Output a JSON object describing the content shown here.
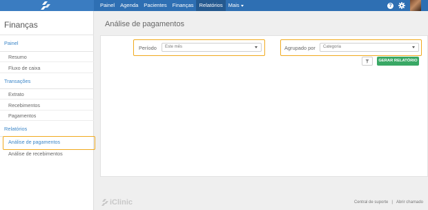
{
  "topbar": {
    "nav": [
      {
        "label": "Painel"
      },
      {
        "label": "Agenda"
      },
      {
        "label": "Pacientes"
      },
      {
        "label": "Finanças"
      },
      {
        "label": "Relatórios"
      },
      {
        "label": "Mais"
      }
    ],
    "active_nav": "Relatórios",
    "help_label": "?"
  },
  "sidebar": {
    "title": "Finanças",
    "groups": [
      {
        "label": "Painel",
        "items": [
          {
            "label": "Resumo"
          },
          {
            "label": "Fluxo de caixa"
          }
        ]
      },
      {
        "label": "Transações",
        "items": [
          {
            "label": "Extrato"
          },
          {
            "label": "Recebimentos"
          },
          {
            "label": "Pagamentos"
          }
        ]
      },
      {
        "label": "Relatórios",
        "items": [
          {
            "label": "Análise de pagamentos"
          },
          {
            "label": "Análise de recebimentos"
          }
        ]
      }
    ],
    "active_item": "Análise de pagamentos"
  },
  "main": {
    "title": "Análise de pagamentos",
    "filters": {
      "period_label": "Período",
      "period_value": "Este mês",
      "group_label": "Agrupado por",
      "group_value": "Categoria"
    },
    "generate_label": "GERAR RELATÓRIO"
  },
  "footer": {
    "logo_text": "iClinic",
    "links": [
      {
        "label": "Central de suporte"
      },
      {
        "label": "Abrir chamado"
      }
    ],
    "divider": "|"
  },
  "colors": {
    "topbar": "#2e6fb3",
    "accent": "#3b86c8",
    "highlight": "#f0a91c",
    "primary_button": "#39a865"
  },
  "icons": [
    "logo-icon",
    "help-icon",
    "gear-icon",
    "avatar",
    "filter-icon",
    "chevron-down-icon",
    "iclinic-logo-icon"
  ]
}
